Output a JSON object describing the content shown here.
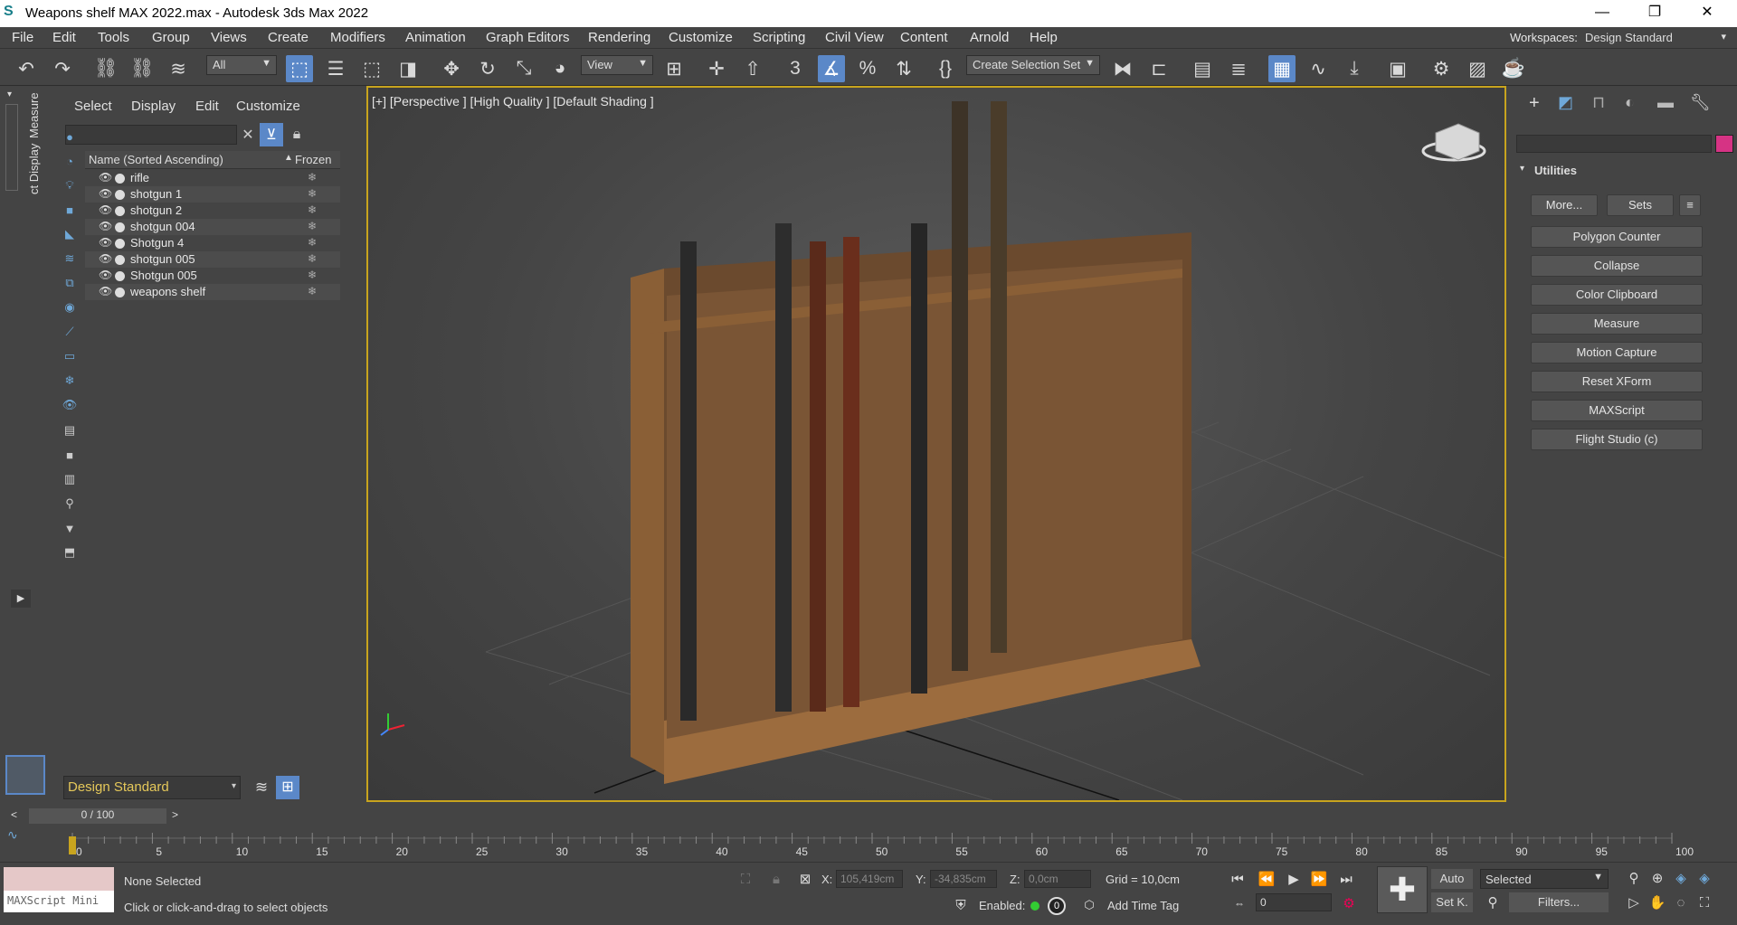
{
  "window": {
    "title": "Weapons shelf MAX 2022.max - Autodesk 3ds Max 2022",
    "controls": [
      "—",
      "❐",
      "✕"
    ]
  },
  "menu": [
    "File",
    "Edit",
    "Tools",
    "Group",
    "Views",
    "Create",
    "Modifiers",
    "Animation",
    "Graph Editors",
    "Rendering",
    "Customize",
    "Scripting",
    "Civil View",
    "Content",
    "Arnold",
    "Help"
  ],
  "workspace": {
    "label": "Workspaces:",
    "value": "Design Standard"
  },
  "toolbar": {
    "filter_value": "All",
    "ref_coord_value": "View",
    "selection_set_placeholder": "Create Selection Set"
  },
  "side_tabs": {
    "measure": "Measure",
    "display": "ct Display"
  },
  "scene_explorer": {
    "tabs": [
      "Select",
      "Display",
      "Edit",
      "Customize"
    ],
    "columns": {
      "name": "Name (Sorted Ascending)",
      "frozen": "Frozen"
    },
    "objects": [
      "rifle",
      "shotgun 1",
      "shotgun 2",
      "shotgun 004",
      "Shotgun 4",
      "shotgun 005",
      "Shotgun 005",
      "weapons shelf"
    ],
    "workspace_value": "Design Standard"
  },
  "viewport": {
    "label": "[+] [Perspective ] [High Quality ] [Default Shading ]"
  },
  "command_panel": {
    "rollout_title": "Utilities",
    "top_buttons": [
      "More...",
      "Sets"
    ],
    "utilities": [
      "Polygon Counter",
      "Collapse",
      "Color Clipboard",
      "Measure",
      "Motion Capture",
      "Reset XForm",
      "MAXScript",
      "Flight Studio (c)"
    ],
    "accent_color": "#d63384"
  },
  "timeline": {
    "frame_readout": "0 / 100",
    "ticks": [
      "0",
      "5",
      "10",
      "15",
      "20",
      "25",
      "30",
      "35",
      "40",
      "45",
      "50",
      "55",
      "60",
      "65",
      "70",
      "75",
      "80",
      "85",
      "90",
      "95",
      "100"
    ]
  },
  "status": {
    "maxscript": "MAXScript Mini",
    "selection": "None Selected",
    "prompt": "Click or click-and-drag to select objects",
    "x_label": "X:",
    "x_value": "105,419cm",
    "y_label": "Y:",
    "y_value": "-34,835cm",
    "z_label": "Z:",
    "z_value": "0,0cm",
    "grid": "Grid = 10,0cm",
    "enabled_label": "Enabled:",
    "add_time_tag": "Add Time Tag",
    "auto_label": "Auto",
    "selected_value": "Selected",
    "setk_label": "Set K.",
    "filters_label": "Filters...",
    "frame_value": "0"
  }
}
